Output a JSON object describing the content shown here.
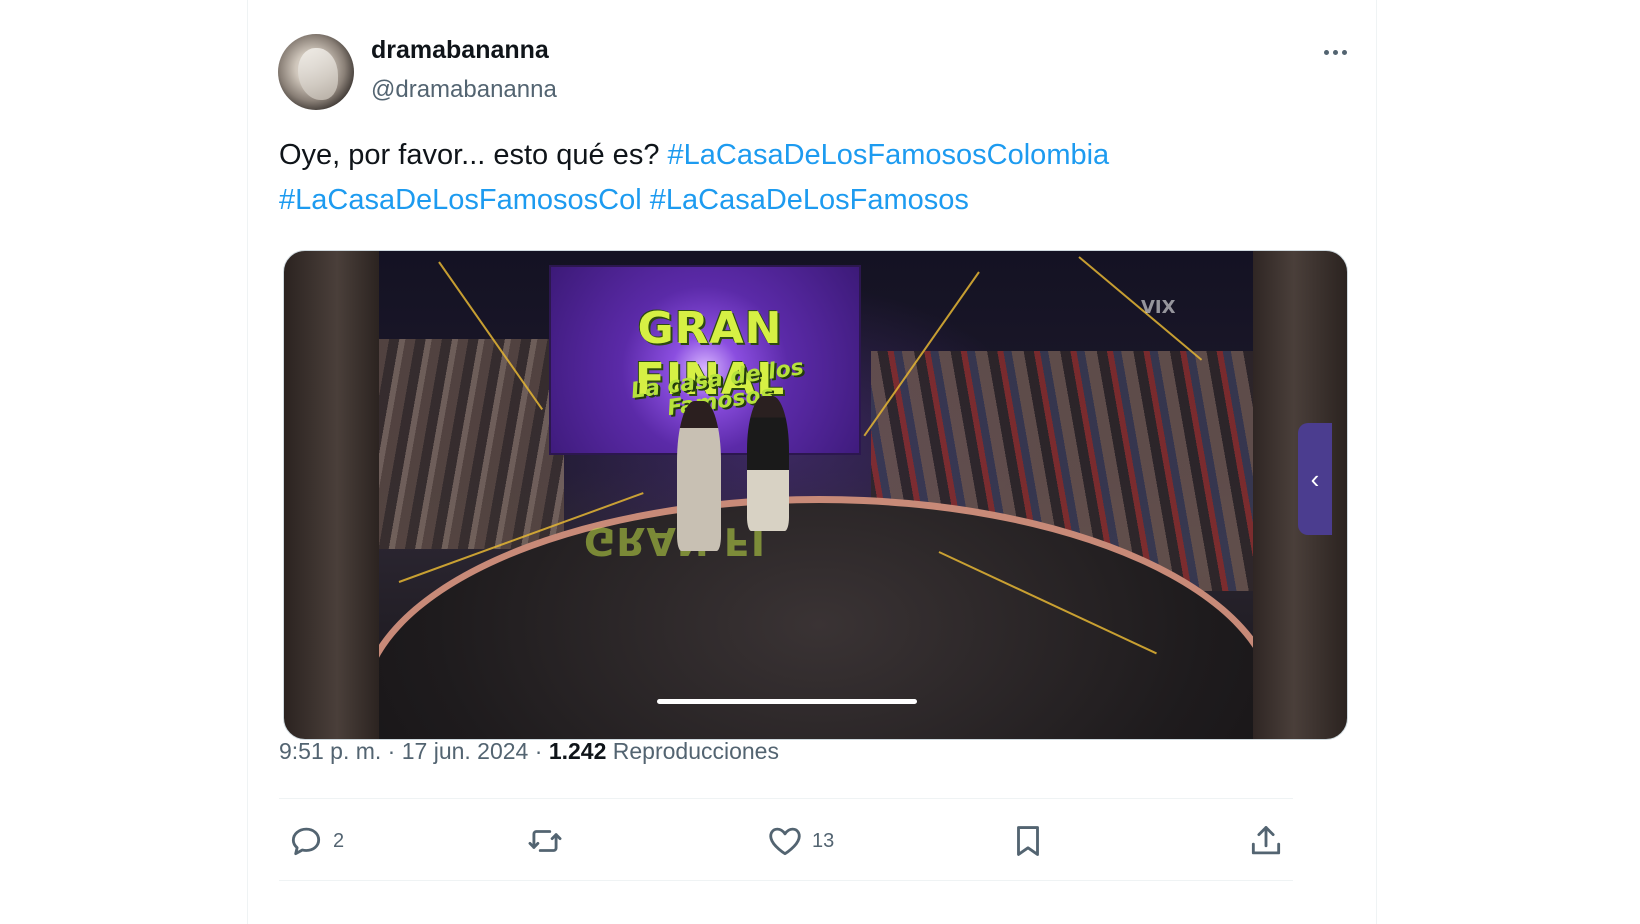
{
  "author": {
    "display_name": "dramabananna",
    "handle": "@dramabananna"
  },
  "tweet": {
    "text": "Oye, por favor... esto qué es? ",
    "hashtags": [
      "#LaCasaDeLosFamososColombia",
      "#LaCasaDeLosFamososCol",
      "#LaCasaDeLosFamosos"
    ]
  },
  "media": {
    "screen_title": "GRAN FINAL",
    "screen_logo": "La casa de los Famosos",
    "floor_reflection": "GRAN FI",
    "watermark": "VIX",
    "side_tab_icon": "chevron-left-icon"
  },
  "meta": {
    "time": "9:51 p. m.",
    "separator": " · ",
    "date": "17 jun. 2024",
    "views_count": "1.242",
    "views_label": " Reproducciones"
  },
  "actions": {
    "replies": "2",
    "reposts": "",
    "likes": "13"
  },
  "colors": {
    "link": "#1d9bf0",
    "secondary_text": "#536471",
    "primary_text": "#0f1419"
  }
}
